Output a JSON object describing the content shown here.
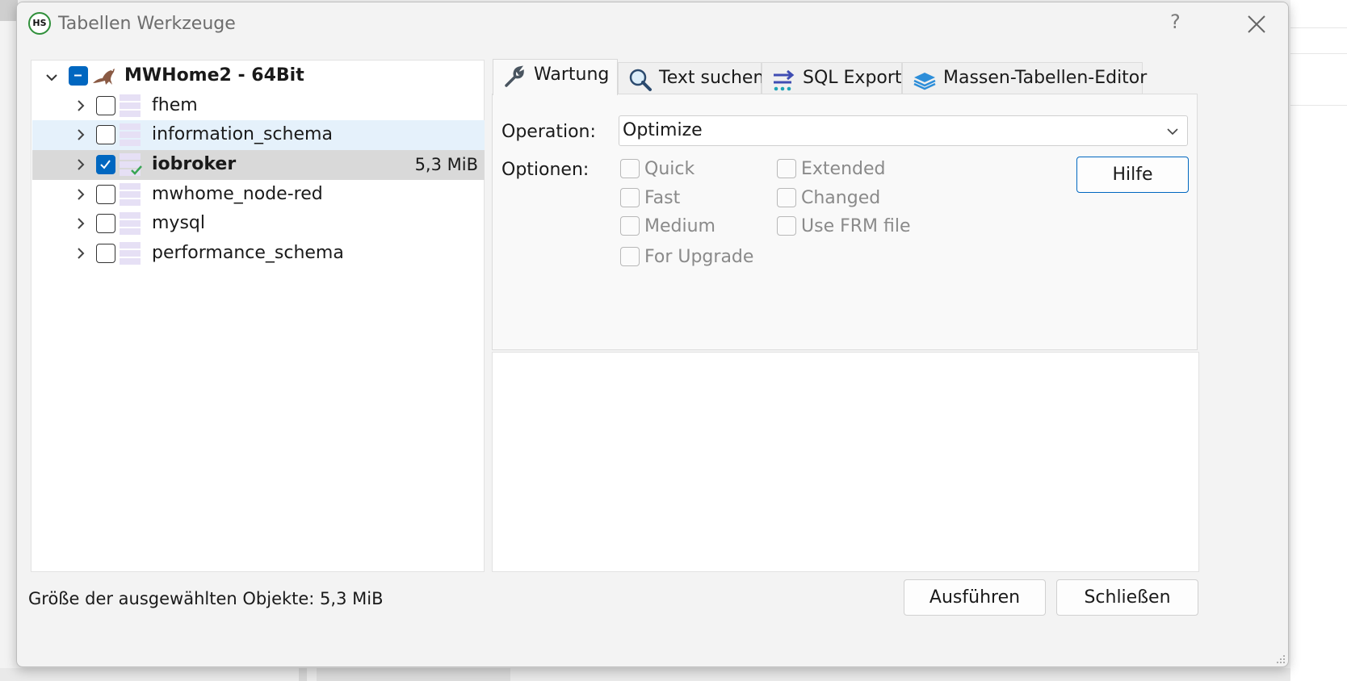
{
  "window": {
    "logo_text": "HS",
    "title": "Tabellen Werkzeuge",
    "help_glyph": "?"
  },
  "tree": {
    "root": {
      "label": "MWHome2 - 64Bit",
      "checkbox": "partial",
      "expanded": true
    },
    "databases": [
      {
        "label": "fhem",
        "checked": false,
        "size": ""
      },
      {
        "label": "information_schema",
        "checked": false,
        "size": "",
        "state": "hover"
      },
      {
        "label": "iobroker",
        "checked": true,
        "size": "5,3 MiB",
        "state": "selected"
      },
      {
        "label": "mwhome_node-red",
        "checked": false,
        "size": ""
      },
      {
        "label": "mysql",
        "checked": false,
        "size": ""
      },
      {
        "label": "performance_schema",
        "checked": false,
        "size": ""
      }
    ]
  },
  "tabs": [
    {
      "label": "Wartung",
      "icon": "wrench-icon",
      "active": true
    },
    {
      "label": "Text suchen",
      "icon": "magnifier-icon",
      "active": false
    },
    {
      "label": "SQL Export",
      "icon": "export-arrow-icon",
      "active": false
    },
    {
      "label": "Massen-Tabellen-Editor",
      "icon": "layers-icon",
      "active": false
    }
  ],
  "maintenance": {
    "operation_label": "Operation:",
    "operation_value": "Optimize",
    "options_label": "Optionen:",
    "options_col1": [
      "Quick",
      "Fast",
      "Medium",
      "For Upgrade"
    ],
    "options_col2": [
      "Extended",
      "Changed",
      "Use FRM file"
    ],
    "help_button": "Hilfe"
  },
  "footer": {
    "status": "Größe der ausgewählten Objekte: 5,3 MiB",
    "execute_button": "Ausführen",
    "close_button": "Schließen"
  },
  "colors": {
    "accent": "#0067c0",
    "selected_row": "#d9d9d9",
    "hover_row": "#e5f1fb",
    "db_icon": "#e6e0f5"
  }
}
